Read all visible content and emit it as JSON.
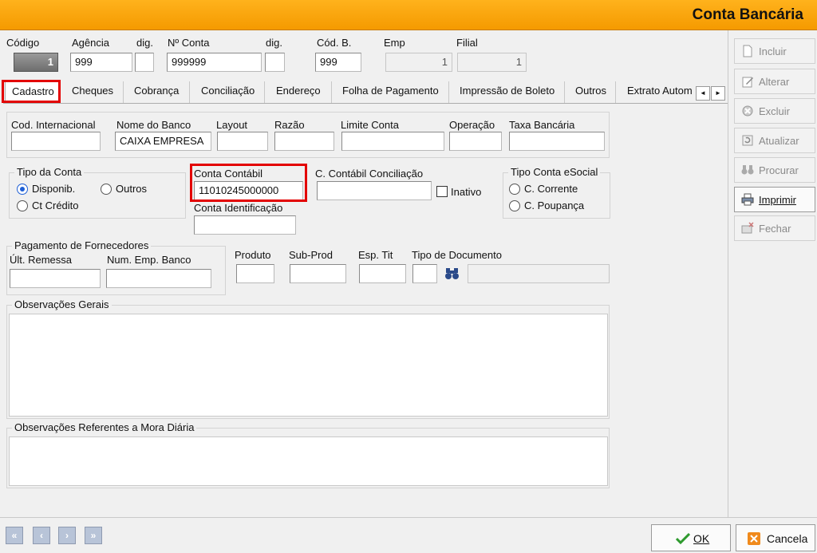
{
  "window": {
    "title": "Conta Bancária"
  },
  "header": {
    "codigo_label": "Código",
    "codigo_value": "1",
    "agencia_label": "Agência",
    "agencia_value": "999",
    "dig1_label": "dig.",
    "dig1_value": "",
    "nconta_label": "Nº Conta",
    "nconta_value": "999999",
    "dig2_label": "dig.",
    "dig2_value": "",
    "codb_label": "Cód. B.",
    "codb_value": "999",
    "emp_label": "Emp",
    "emp_value": "1",
    "filial_label": "Filial",
    "filial_value": "1"
  },
  "tabs": [
    {
      "label": "Cadastro"
    },
    {
      "label": "Cheques"
    },
    {
      "label": "Cobrança"
    },
    {
      "label": "Conciliação"
    },
    {
      "label": "Endereço"
    },
    {
      "label": "Folha de Pagamento"
    },
    {
      "label": "Impressão de Boleto"
    },
    {
      "label": "Outros"
    },
    {
      "label": "Extrato Autom"
    }
  ],
  "tab_scroll": {
    "left": "◄",
    "right": "►"
  },
  "cadastro": {
    "cod_internacional_label": "Cod. Internacional",
    "cod_internacional_value": "",
    "nome_banco_label": "Nome do Banco",
    "nome_banco_value": "CAIXA EMPRESA",
    "layout_label": "Layout",
    "layout_value": "",
    "razao_label": "Razão",
    "razao_value": "",
    "limite_label": "Limite Conta",
    "limite_value": "",
    "operacao_label": "Operação",
    "operacao_value": "",
    "taxa_label": "Taxa Bancária",
    "taxa_value": "",
    "tipo_conta": {
      "title": "Tipo da Conta",
      "options": [
        {
          "label": "Disponib.",
          "selected": true
        },
        {
          "label": "Outros",
          "selected": false
        },
        {
          "label": "Ct Crédito",
          "selected": false
        }
      ]
    },
    "conta_contabil_label": "Conta Contábil",
    "conta_contabil_value": "11010245000000",
    "conta_ident_label": "Conta Identificação",
    "conta_ident_value": "",
    "cc_conciliacao_label": "C. Contábil Conciliação",
    "cc_conciliacao_value": "",
    "inativo_label": "Inativo",
    "tipo_esocial": {
      "title": "Tipo Conta eSocial",
      "options": [
        {
          "label": "C. Corrente",
          "selected": false
        },
        {
          "label": "C. Poupança",
          "selected": false
        }
      ]
    },
    "pagamento": {
      "title": "Pagamento de Fornecedores",
      "ult_remessa_label": "Últ. Remessa",
      "ult_remessa_value": "",
      "num_emp_label": "Num. Emp. Banco",
      "num_emp_value": ""
    },
    "produto_label": "Produto",
    "subprod_label": "Sub-Prod",
    "esptit_label": "Esp. Tit",
    "tipo_doc_label": "Tipo de Documento",
    "obs_gerais_label": "Observações Gerais",
    "obs_mora_label": "Observações Referentes a Mora Diária"
  },
  "sidebar": {
    "buttons": [
      {
        "label": "Incluir",
        "icon": "document-icon",
        "enabled": false
      },
      {
        "label": "Alterar",
        "icon": "edit-icon",
        "enabled": false
      },
      {
        "label": "Excluir",
        "icon": "delete-icon",
        "enabled": false
      },
      {
        "label": "Atualizar",
        "icon": "refresh-icon",
        "enabled": false
      },
      {
        "label": "Procurar",
        "icon": "binoculars-icon",
        "enabled": false
      },
      {
        "label": "Imprimir",
        "icon": "printer-icon",
        "enabled": true
      },
      {
        "label": "Fechar",
        "icon": "close-folder-icon",
        "enabled": false
      }
    ]
  },
  "footer": {
    "nav": [
      "first",
      "prev",
      "next",
      "last"
    ],
    "ok_label": "OK",
    "cancel_label": "Cancela"
  },
  "colors": {
    "title_bar": "#f59a00",
    "highlight_box": "#e30000",
    "radio_selected": "#1e5fd6"
  }
}
